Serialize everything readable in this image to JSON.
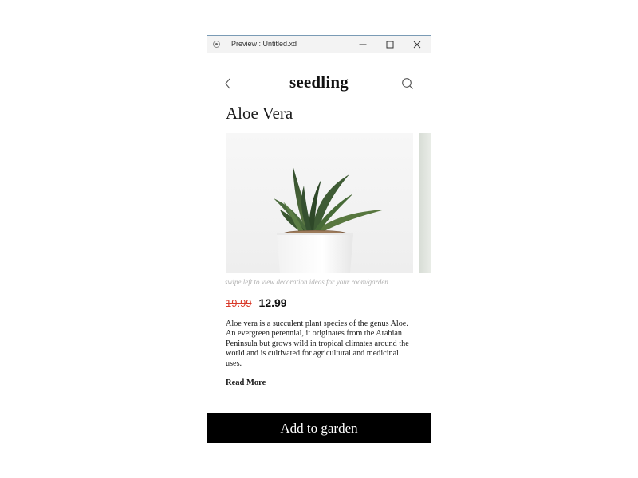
{
  "window": {
    "title": "Preview : Untitled.xd"
  },
  "header": {
    "brand": "seedling"
  },
  "product": {
    "title": "Aloe Vera",
    "swipe_hint": "swipe left to view decoration ideas for your room/garden",
    "old_price": "19.99",
    "price": "12.99",
    "description": "Aloe vera is a succulent plant species of the genus Aloe. An evergreen perennial, it originates from the Arabian Peninsula but grows wild in tropical climates around the world and is cultivated for agricultural and medicinal uses.",
    "read_more": "Read More"
  },
  "cta": {
    "label": "Add to garden"
  },
  "icons": {
    "back": "chevron-left-icon",
    "search": "search-icon",
    "app": "record-icon",
    "minimize": "minimize-icon",
    "maximize": "maximize-icon",
    "close": "close-icon"
  },
  "colors": {
    "old_price": "#d93b2b",
    "cta_background": "#000000",
    "cta_text": "#ffffff"
  }
}
